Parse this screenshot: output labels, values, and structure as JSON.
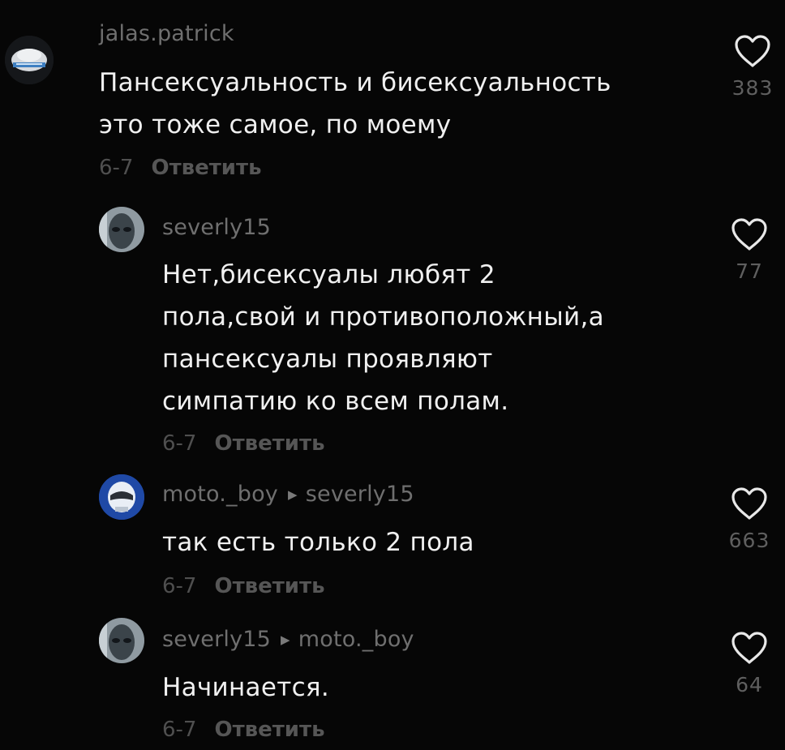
{
  "comments": [
    {
      "username": "jalas.patrick",
      "reply_to": "",
      "text": "Пансексуальность и бисексуальность\nэто тоже самое, по моему",
      "date": "6-7",
      "reply_label": "Ответить",
      "likes": "383",
      "avatar_icon": "cap-avatar"
    },
    {
      "username": "severly15",
      "reply_to": "",
      "text": "Нет,бисексуалы любят 2\nпола,свой и противоположный,а\nпансексуалы проявляют\nсимпатию ко всем полам.",
      "date": "6-7",
      "reply_label": "Ответить",
      "likes": "77",
      "avatar_icon": "alien-face-avatar"
    },
    {
      "username": "moto._boy",
      "reply_to": "severly15",
      "text": "так есть только 2 пола",
      "date": "6-7",
      "reply_label": "Ответить",
      "likes": "663",
      "avatar_icon": "helmet-avatar"
    },
    {
      "username": "severly15",
      "reply_to": "moto._boy",
      "text": "Начинается.",
      "date": "6-7",
      "reply_label": "Ответить",
      "likes": "64",
      "avatar_icon": "alien-face-avatar"
    }
  ],
  "colors": {
    "background": "#060606",
    "text": "#f0f0f0",
    "username": "#6f6f6f",
    "meta": "#4f4f4f"
  },
  "icons": {
    "like": "heart-outline-icon",
    "reply_arrow": "triangle-right-icon"
  }
}
